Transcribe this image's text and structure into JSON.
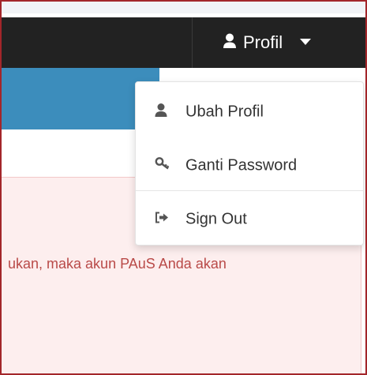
{
  "navbar": {
    "profile_label": "Profil",
    "profile_icon": "user-icon",
    "caret_icon": "caret-down-icon",
    "background": "#222222"
  },
  "dropdown": {
    "items": [
      {
        "label": "Ubah Profil",
        "icon": "user-icon"
      },
      {
        "label": "Ganti Password",
        "icon": "key-icon"
      },
      {
        "label": "Sign Out",
        "icon": "sign-out-icon"
      }
    ]
  },
  "alert": {
    "text": "ukan, maka akun PAuS Anda akan",
    "color": "#b94a48",
    "background": "#fdeeee"
  },
  "colors": {
    "accent_blue": "#3c8dbc",
    "frame_border": "#a3262a"
  }
}
